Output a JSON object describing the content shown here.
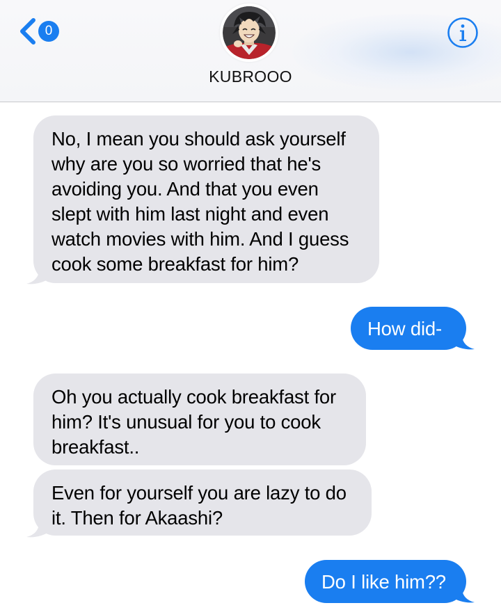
{
  "header": {
    "back_badge": "0",
    "contact_name": "KUBROOO"
  },
  "colors": {
    "accent": "#1a7ef0",
    "incoming_bubble": "#e5e5ea",
    "outgoing_bubble": "#1a7ef0",
    "header_bg": "#f6f6f8"
  },
  "icons": {
    "back": "chevron-left-icon",
    "info": "info-circle-icon",
    "avatar": "contact-avatar"
  },
  "messages": [
    {
      "direction": "incoming",
      "text": "No, I mean you should ask yourself\nwhy are you so worried that he's\navoiding you. And that you even\nslept with him last night and even\nwatch movies with him. And I guess\ncook some breakfast for him?"
    },
    {
      "direction": "outgoing",
      "text": "How did-"
    },
    {
      "direction": "incoming",
      "text": "Oh you actually cook breakfast for\nhim? It's unusual for you to cook\nbreakfast.."
    },
    {
      "direction": "incoming",
      "text": "Even for yourself you are lazy to do\nit. Then for Akaashi?"
    },
    {
      "direction": "outgoing",
      "text": "Do I like him??"
    }
  ]
}
